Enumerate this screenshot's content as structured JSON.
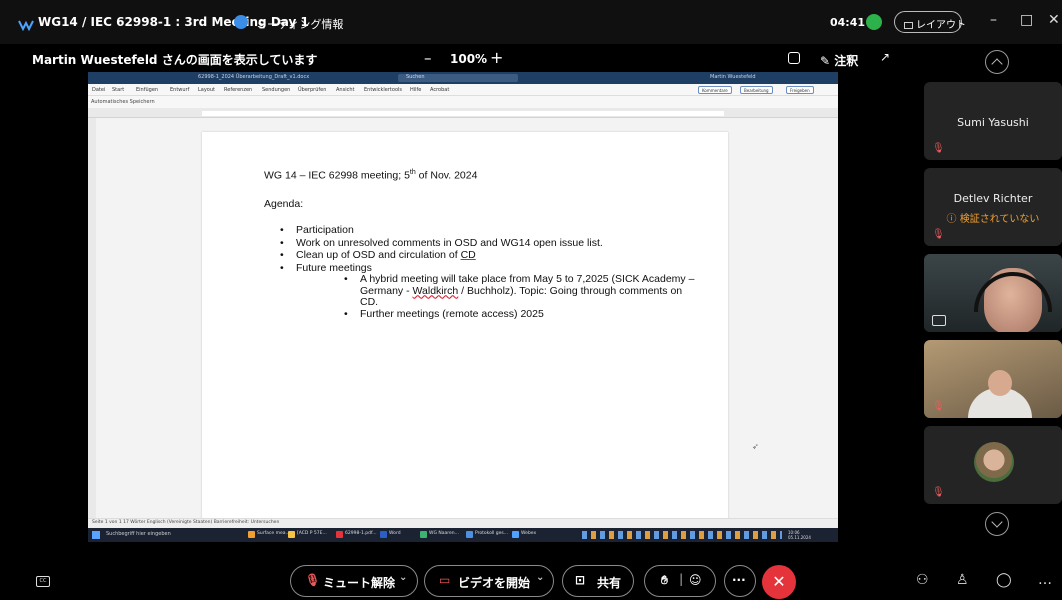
{
  "titlebar": {
    "meeting_title": "WG14 / IEC 62998-1 : 3rd Meeting Day 1",
    "info_label": "ミーティング情報",
    "timer": "04:41",
    "layout_label": "レイアウト",
    "minimize": "–",
    "maximize": "□",
    "close": "✕"
  },
  "sharebar": {
    "sharing_label": "Martin Wuestefeld さんの画面を表示しています",
    "zoom_out": "–",
    "zoom_level": "100%",
    "zoom_in": "+",
    "annotate_label": "注釈",
    "expand": "↗"
  },
  "shared_screen": {
    "word_title": "62998-1_2024 Überarbeitung_Draft_v1.docx",
    "search_placeholder": "Suchen",
    "user_name": "Martin Wuestefeld",
    "menu": [
      "Datei",
      "Start",
      "Einfügen",
      "Entwurf",
      "Layout",
      "Referenzen",
      "Sendungen",
      "Überprüfen",
      "Ansicht",
      "Entwicklertools",
      "Hilfe",
      "Acrobat"
    ],
    "comments_btn": "Kommentare",
    "editing_btn": "Bearbeitung",
    "share_btn": "Freigeben",
    "quick_access": "Automatisches Speichern",
    "status_text": "Seite 1 von 1   17 Wörter   Englisch (Vereinigte Staaten)   Barrierefreiheit: Untersuchen",
    "document": {
      "title_main": "WG 14 – IEC 62998 meeting; 5",
      "title_sup": "th",
      "title_tail": " of Nov. 2024",
      "agenda_label": "Agenda:",
      "items": [
        "Participation",
        "Work on unresolved comments in OSD and WG14 open issue list.",
        "Clean up of OSD and circulation of ",
        "Future meetings"
      ],
      "item3_link": "CD",
      "sub_items": [
        {
          "pre": "A hybrid meeting will take place from May 5 to 7,2025 (SICK Academy – Germany - ",
          "red": "Waldkirch",
          "post": " / Buchholz). Topic: Going through comments on CD."
        },
        {
          "pre": "Further meetings (remote access) 2025",
          "red": "",
          "post": ""
        }
      ]
    },
    "taskbar": {
      "search": "Suchbegriff hier eingeben",
      "apps": [
        "Surface mea...",
        "[ACD P 57E...",
        "62998-1.pdf...",
        "Word",
        "WG Naaren...",
        "Protokoll ges...",
        "Webex"
      ],
      "clock_time": "10:06",
      "clock_date": "05.11.2024"
    }
  },
  "participants": [
    {
      "name": "Sumi Yasushi",
      "warning": "",
      "type": "name"
    },
    {
      "name": "Detlev Richter",
      "warning": "ⓘ 検証されていない",
      "type": "name"
    },
    {
      "name": "",
      "warning": "",
      "type": "video"
    },
    {
      "name": "",
      "warning": "",
      "type": "video"
    },
    {
      "name": "",
      "warning": "",
      "type": "avatar"
    }
  ],
  "controls": {
    "mute_label": "ミュート解除",
    "video_label": "ビデオを開始",
    "share_label": "共有",
    "more_label": "···",
    "end_label": "✕"
  },
  "colors": {
    "accent_green": "#2db14a",
    "end_red": "#e5333b",
    "muted_red": "#f15a5a",
    "warning_orange": "#f0a030"
  }
}
